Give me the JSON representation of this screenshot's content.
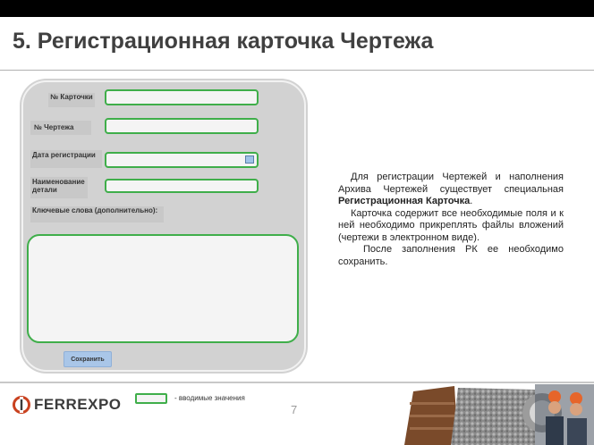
{
  "slide": {
    "title": "5. Регистрационная карточка Чертежа",
    "page_number": "7"
  },
  "form": {
    "card_number_label": "№ Карточки",
    "card_number_value": "",
    "drawing_number_label": "№ Чертежа",
    "drawing_number_value": "",
    "registration_date_label": "Дата регистрации",
    "registration_date_value": "",
    "part_name_label": "Наименование детали",
    "part_name_value": "",
    "keywords_label": "Ключевые слова (дополнительно):",
    "keywords_value": "",
    "save_label": "Сохранить"
  },
  "description": {
    "para1_prefix": "Для регистрации Чертежей и наполнения Архива Чертежей существует специальная ",
    "para1_bold": "Регистрационная Карточка",
    "para1_suffix": ".",
    "para2": "Карточка содержит все необходимые поля и к ней необходимо прикреплять файлы вложений (чертежи в электронном виде).",
    "para3": "После заполнения РК ее необходимо сохранить."
  },
  "legend": {
    "text": "- вводимые значения"
  },
  "footer": {
    "logo_text": "FERREXPO"
  },
  "colors": {
    "field_border": "#3fae4a",
    "card_bg": "#d2d2d2",
    "save_button": "#a9c6e8",
    "top_bar": "#000000"
  }
}
